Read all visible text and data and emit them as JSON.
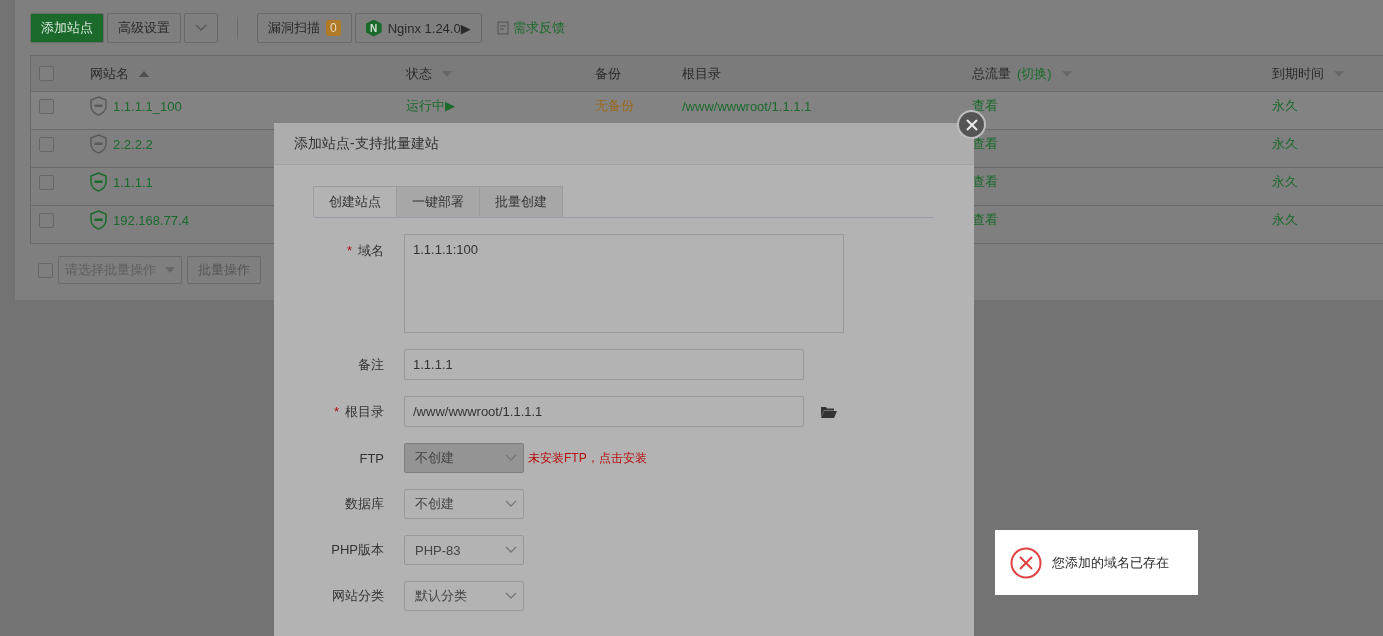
{
  "toolbar": {
    "add_button": "添加站点",
    "advanced_button": "高级设置",
    "scan": {
      "label": "漏洞扫描",
      "count": "0"
    },
    "nginx_button": {
      "logo_text": "N",
      "label": "Nginx 1.24.0▶"
    },
    "feedback_link": "需求反馈"
  },
  "table": {
    "select_all_checked": false,
    "columns": [
      {
        "label": "网站名",
        "sort_ascending": true
      },
      {
        "label": "状态",
        "sort_ascending": false
      },
      {
        "label": "备份"
      },
      {
        "label": "根目录"
      },
      {
        "label": "总流量",
        "link": "(切换)",
        "sort_ascending": false
      },
      {
        "label": "到期时间",
        "sort_ascending": false
      }
    ],
    "rows": [
      {
        "checked": false,
        "name": "1.1.1.1_100",
        "waf_active": false,
        "status": "运行中▶",
        "backup": "无备份",
        "root": "/www/wwwroot/1.1.1.1",
        "traffic": "查看",
        "expiry": "永久"
      },
      {
        "checked": false,
        "name": "2.2.2.2",
        "waf_active": false,
        "traffic": "查看",
        "expiry": "永久"
      },
      {
        "checked": false,
        "name": "1.1.1.1",
        "waf_active": true,
        "traffic": "查看",
        "expiry": "永久"
      },
      {
        "checked": false,
        "name": "192.168.77.4",
        "waf_active": true,
        "traffic": "查看",
        "expiry": "永久"
      }
    ]
  },
  "footer": {
    "checked": false,
    "batch_select": {
      "placeholder": "请选择批量操作"
    },
    "batch_button": "批量操作"
  },
  "modal": {
    "title": "添加站点-支持批量建站",
    "tabs": [
      {
        "label": "创建站点",
        "selected": true
      },
      {
        "label": "一键部署",
        "selected": false
      },
      {
        "label": "批量创建",
        "selected": false
      }
    ],
    "fields": [
      {
        "kind": "textarea",
        "label": "域名",
        "required_mark": "*",
        "value": "1.1.1.1:100"
      },
      {
        "kind": "input",
        "label": "备注",
        "value": "1.1.1.1"
      },
      {
        "kind": "input",
        "label": "根目录",
        "required_mark": "*",
        "value": "/www/wwwroot/1.1.1.1",
        "folder_button": true
      },
      {
        "kind": "select",
        "label": "FTP",
        "value": "不创建",
        "disabled": true,
        "note": "未安装FTP，点击安装"
      },
      {
        "kind": "select",
        "label": "数据库",
        "value": "不创建",
        "disabled": false
      },
      {
        "kind": "select",
        "label": "PHP版本",
        "value": "PHP-83",
        "disabled": false
      },
      {
        "kind": "select",
        "label": "网站分类",
        "value": "默认分类",
        "disabled": false
      }
    ]
  },
  "toast": {
    "message": "您添加的域名已存在"
  }
}
